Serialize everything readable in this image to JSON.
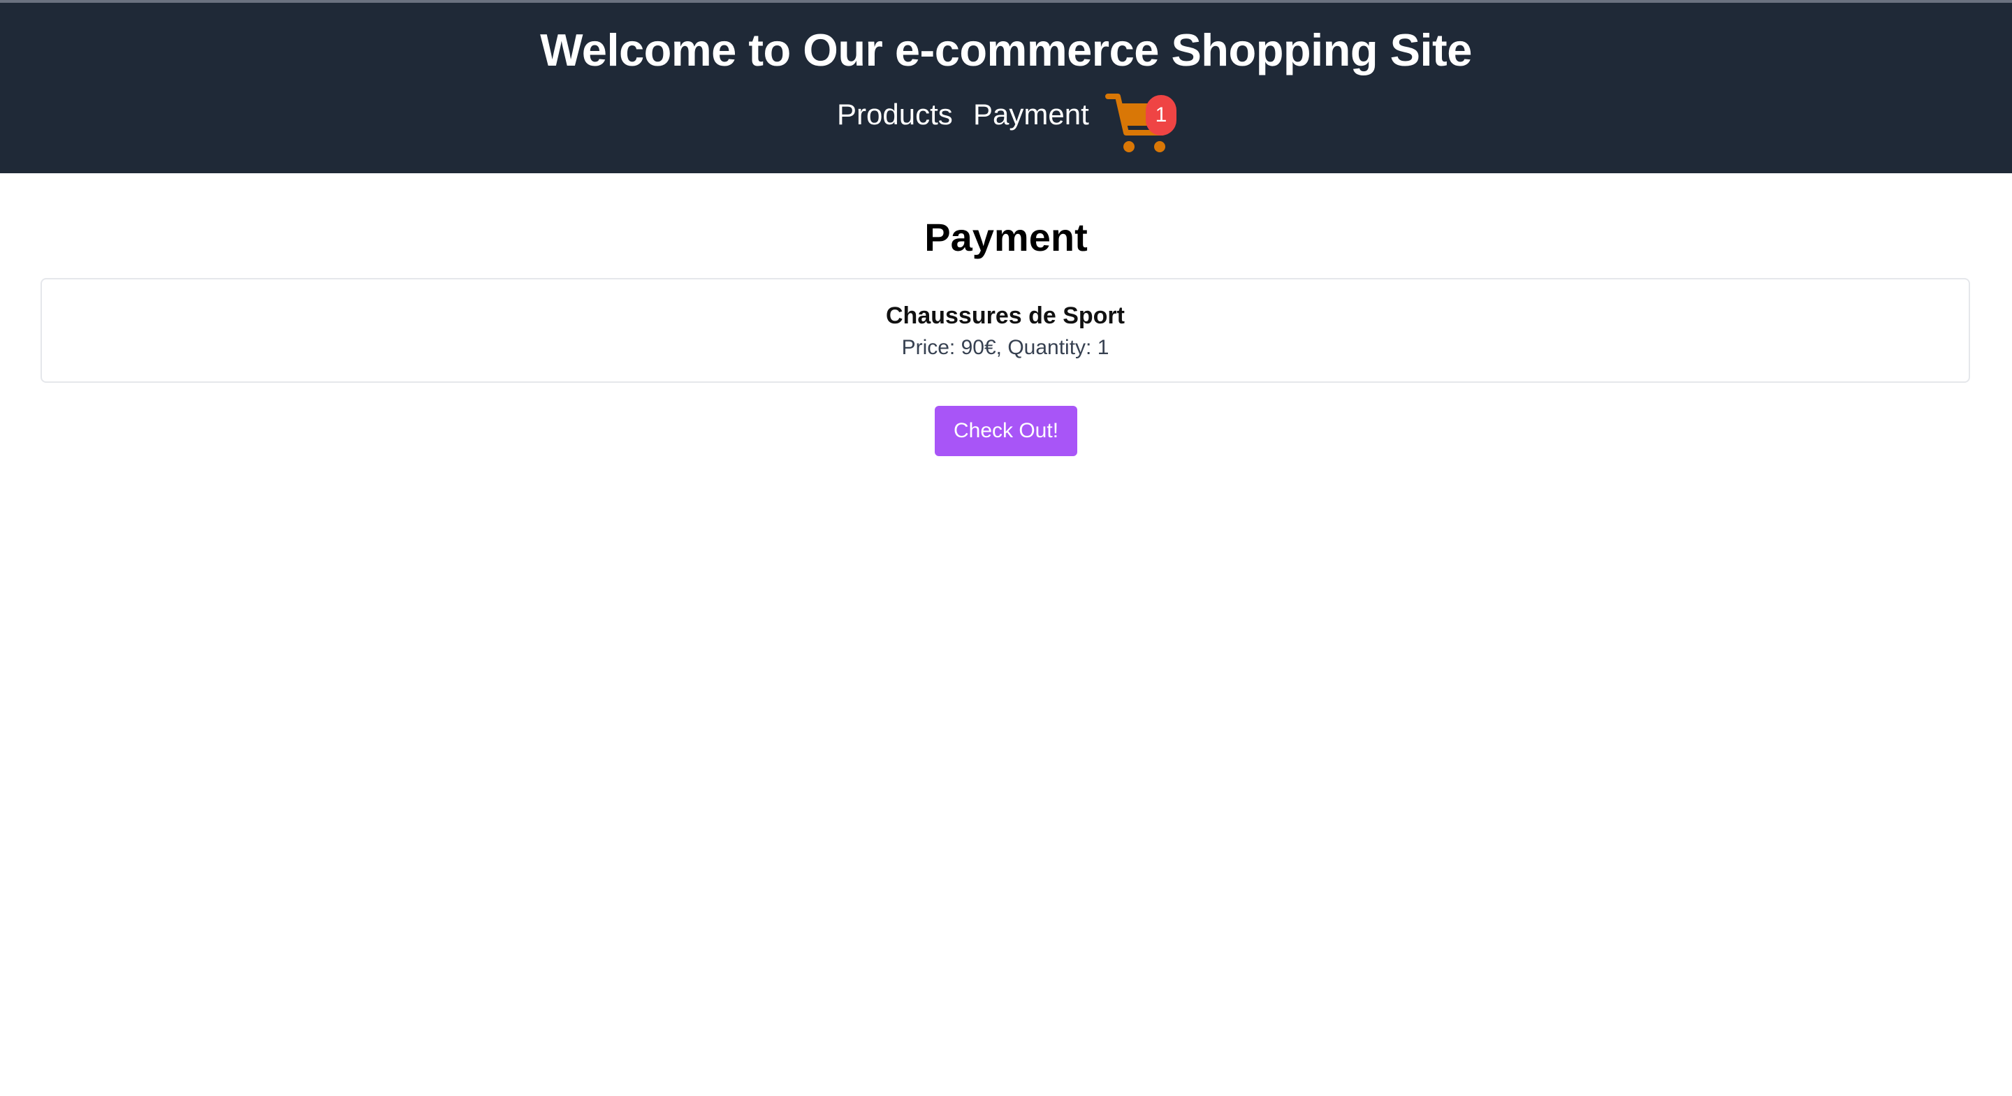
{
  "header": {
    "title": "Welcome to Our e-commerce Shopping Site",
    "nav": {
      "products_label": "Products",
      "payment_label": "Payment"
    },
    "cart": {
      "icon": "shopping-cart-icon",
      "count": "1",
      "icon_color": "#d97706",
      "badge_color": "#ef4444"
    },
    "background_color": "#1f2937"
  },
  "main": {
    "title": "Payment",
    "items": [
      {
        "name": "Chaussures de Sport",
        "details": "Price: 90€, Quantity: 1"
      }
    ],
    "checkout_label": "Check Out!",
    "checkout_color": "#a855f7"
  }
}
